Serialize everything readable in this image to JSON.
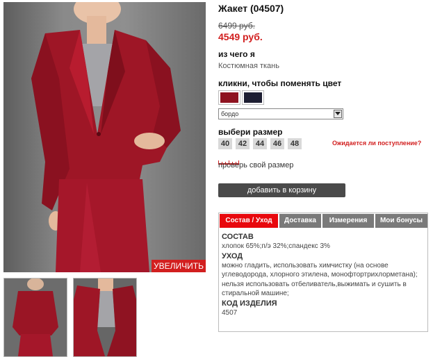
{
  "product": {
    "title": "Жакет (04507)",
    "old_price": "6499 руб.",
    "new_price": "4549 руб.",
    "material_label": "из чего я",
    "material_value": "Костюмная ткань",
    "color_label": "кликни, чтобы поменять цвет",
    "selected_color": "бордо",
    "swatches": [
      {
        "name": "бордо",
        "color": "#8e1320"
      },
      {
        "name": "dark-navy",
        "color": "#1e1f33"
      }
    ],
    "size_label": "выбери размер",
    "sizes": [
      "40",
      "42",
      "44",
      "46",
      "48"
    ],
    "awaiting_link": "Ожидается ли поступление?",
    "check_size": "проверь свой размер",
    "add_to_cart": "добавить в корзину",
    "zoom_label": "УВЕЛИЧИТЬ"
  },
  "tabs": [
    {
      "label": "Состав / Уход",
      "active": true
    },
    {
      "label": "Доставка",
      "active": false
    },
    {
      "label": "Измерения",
      "active": false
    },
    {
      "label": "Мои бонусы",
      "active": false
    }
  ],
  "info": {
    "composition_heading": "СОСТАВ",
    "composition_text": "хлопок 65%;п/э 32%;спандекс 3%",
    "care_heading": "УХОД",
    "care_text": "можно гладить, использовать химчистку (на основе углеводорода, хлорного этилена, монофтортрихлорметана); нельзя использовать отбеливатель,выжимать и сушить в стиральной машине;",
    "code_heading": "КОД ИЗДЕЛИЯ",
    "code_value": "4507"
  },
  "colors": {
    "accent_red": "#d21f1f",
    "tab_active": "#e8080d",
    "tab_inactive": "#7a7a7a",
    "button_dark": "#4a4a4a"
  }
}
